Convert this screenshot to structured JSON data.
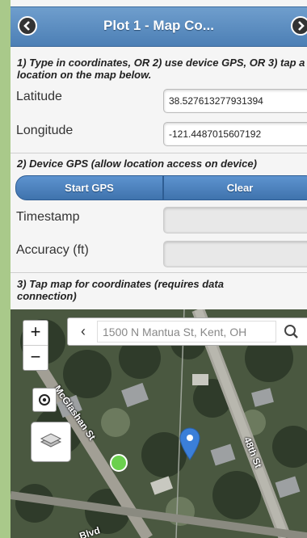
{
  "header": {
    "title": "Plot 1 - Map Co...",
    "back_icon": "chevron-left-icon",
    "forward_icon": "chevron-right-icon"
  },
  "section1": {
    "title": "1) Type in coordinates, OR 2) use device GPS, OR 3) tap a location on the map below.",
    "latitude_label": "Latitude",
    "latitude_value": "38.527613277931394",
    "longitude_label": "Longitude",
    "longitude_value": "-121.4487015607192"
  },
  "section2": {
    "title": "2) Device GPS (allow location access on device)",
    "start_gps": "Start GPS",
    "clear": "Clear",
    "timestamp_label": "Timestamp",
    "timestamp_value": "",
    "accuracy_label": "Accuracy (ft)",
    "accuracy_value": ""
  },
  "section3": {
    "title": "3) Tap map for coordinates (requires data connection)"
  },
  "map": {
    "zoom_in": "+",
    "zoom_out": "−",
    "search_placeholder": "1500 N Mantua St, Kent, OH",
    "back_chevron": "‹",
    "streets": [
      "McGlashan St",
      "48th St",
      "Blvd"
    ],
    "accent_blue": "#3b7fd9",
    "marker_green": "#6bd04e"
  }
}
